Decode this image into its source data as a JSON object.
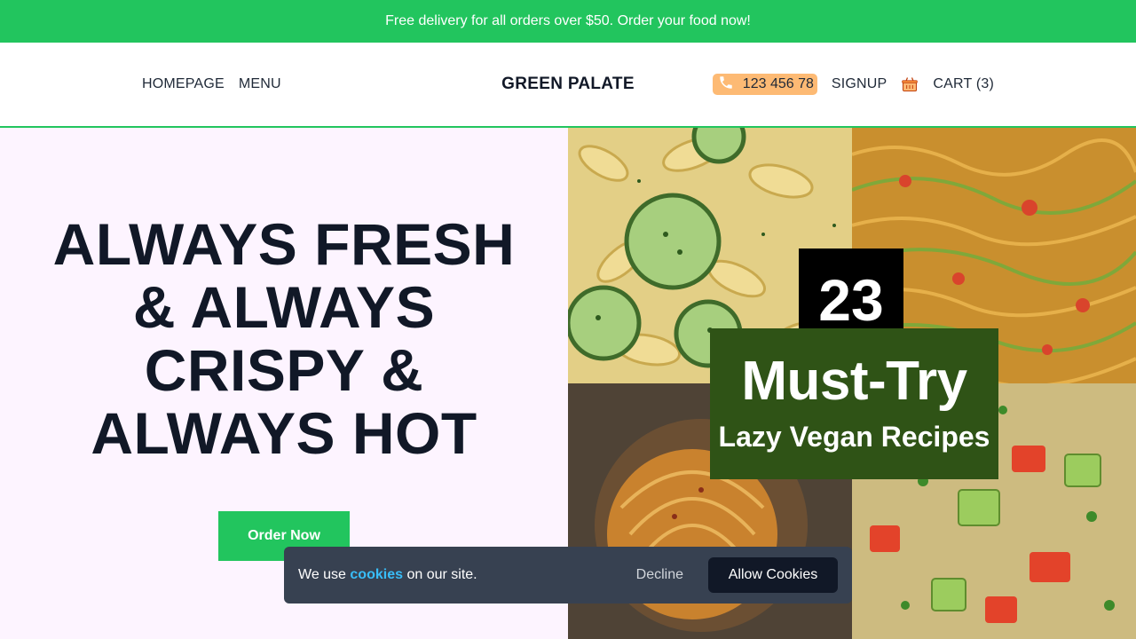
{
  "promo": {
    "text": "Free delivery for all orders over $50. Order your food now!"
  },
  "header": {
    "nav_left": [
      {
        "label": "HOMEPAGE"
      },
      {
        "label": "MENU"
      }
    ],
    "logo": "GREEN PALATE",
    "phone": "123 456 78",
    "signup": "SIGNUP",
    "cart": "CART (3)"
  },
  "hero": {
    "title_lines": [
      "ALWAYS FRESH",
      "& ALWAYS",
      "CRISPY &",
      "ALWAYS HOT"
    ],
    "cta": "Order Now",
    "image": {
      "badge_number": "23",
      "badge_main": "Must-Try",
      "badge_sub": "Lazy Vegan Recipes"
    }
  },
  "cookie": {
    "prefix": "We use",
    "link": "cookies",
    "suffix": "on our site.",
    "decline": "Decline",
    "allow": "Allow Cookies"
  },
  "colors": {
    "accent": "#22c55e",
    "phone_pill": "#fdba74",
    "hero_bg": "#fdf4ff",
    "cookie_bg": "#374151",
    "cookie_link": "#38bdf8",
    "allow_bg": "#111827",
    "badge_green": "#2f5316"
  }
}
